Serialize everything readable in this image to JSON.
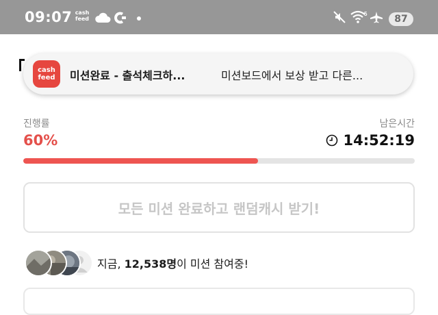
{
  "status_bar": {
    "time": "09:07",
    "app_badge_line1": "cash",
    "app_badge_line2": "feed",
    "battery": "87",
    "icons": [
      "cashfeed-icon",
      "cloud-icon",
      "c-app-icon",
      "dot-icon",
      "mute-icon",
      "wifi-icon",
      "airplane-icon",
      "battery-icon"
    ]
  },
  "notification": {
    "app_icon_line1": "cash",
    "app_icon_line2": "feed",
    "title": "미션완료 - 출석체크하...",
    "body": "미션보드에서 보상 받고 다른..."
  },
  "progress": {
    "label": "진행률",
    "value_text": "60%",
    "fraction": 0.6,
    "accent_color": "#e4504b"
  },
  "remaining": {
    "label": "남은시간",
    "time": "14:52:19"
  },
  "reward_button": {
    "label": "모든 미션 완료하고 랜덤캐시 받기!"
  },
  "participants": {
    "prefix": "지금, ",
    "count": "12,538명",
    "suffix": "이 미션 참여중!"
  }
}
